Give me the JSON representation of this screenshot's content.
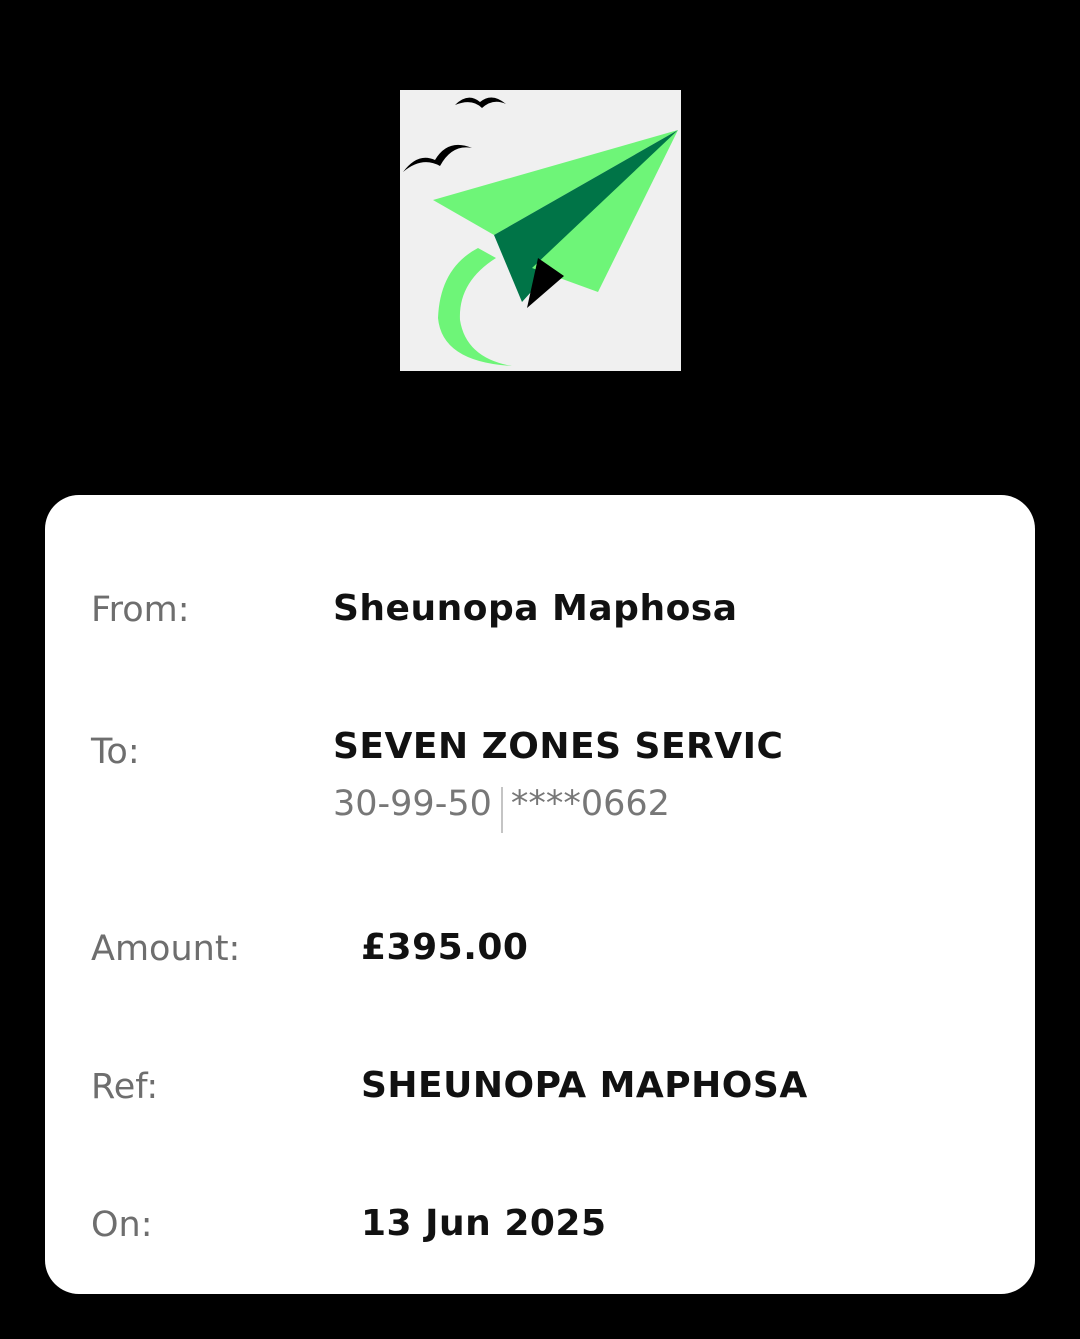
{
  "colors": {
    "background": "#000000",
    "card": "#ffffff",
    "label": "#6e6e6e",
    "value": "#111111",
    "brand_light_green": "#6ef578",
    "brand_dark_green": "#007447"
  },
  "logo": {
    "icon": "paper-plane-logo"
  },
  "transfer": {
    "from": {
      "label": "From:",
      "value": "Sheunopa Maphosa"
    },
    "to": {
      "label": "To:",
      "value": "SEVEN ZONES SERVIC",
      "sort_code": "30-99-50",
      "account": "****0662"
    },
    "amount": {
      "label": "Amount:",
      "value": "£395.00"
    },
    "ref": {
      "label": "Ref:",
      "value": "SHEUNOPA MAPHOSA"
    },
    "on": {
      "label": "On:",
      "value": "13 Jun 2025"
    }
  }
}
